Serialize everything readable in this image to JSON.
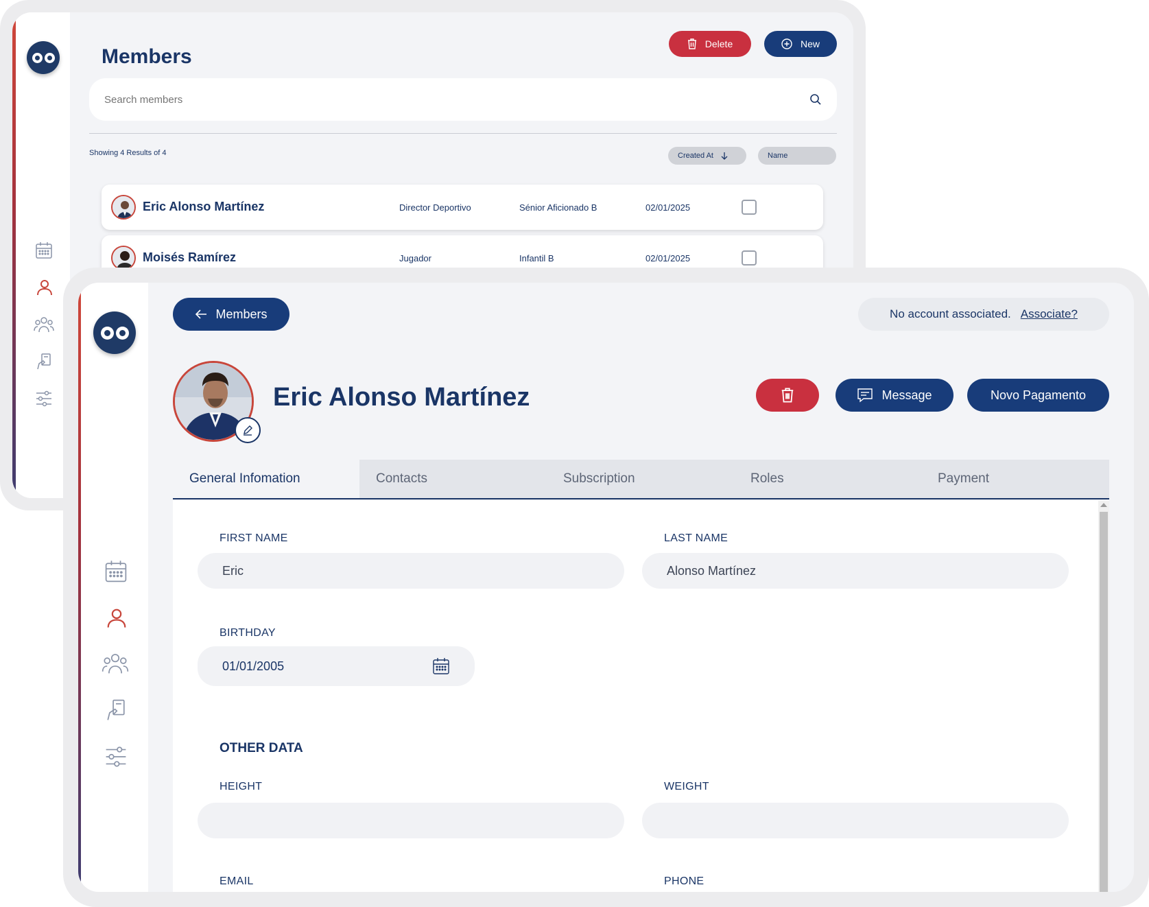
{
  "list_window": {
    "title": "Members",
    "delete_label": "Delete",
    "new_label": "New",
    "search_placeholder": "Search members",
    "results_text": "Showing 4 Results of 4",
    "sort_created": "Created At",
    "sort_name": "Name",
    "rows": [
      {
        "name": "Eric Alonso Martínez",
        "role": "Director Deportivo",
        "team": "Sénior Aficionado B",
        "date": "02/01/2025"
      },
      {
        "name": "Moisés Ramírez",
        "role": "Jugador",
        "team": "Infantil B",
        "date": "02/01/2025"
      }
    ]
  },
  "detail_window": {
    "back_label": "Members",
    "account_text": "No account associated.",
    "associate_link": "Associate?",
    "member_name": "Eric Alonso Martínez",
    "message_label": "Message",
    "payment_label": "Novo Pagamento",
    "tabs": [
      "General Infomation",
      "Contacts",
      "Subscription",
      "Roles",
      "Payment"
    ],
    "form": {
      "first_name_label": "FIRST NAME",
      "first_name": "Eric",
      "last_name_label": "LAST NAME",
      "last_name": "Alonso Martínez",
      "birthday_label": "BIRTHDAY",
      "birthday": "01/01/2005",
      "other_data_heading": "OTHER DATA",
      "height_label": "HEIGHT",
      "height": "",
      "weight_label": "WEIGHT",
      "weight": "",
      "email_label": "EMAIL",
      "phone_label": "PHONE"
    }
  },
  "colors": {
    "brand_navy": "#183c7a",
    "danger_red": "#c9303f",
    "active_icon": "#c8463b"
  }
}
